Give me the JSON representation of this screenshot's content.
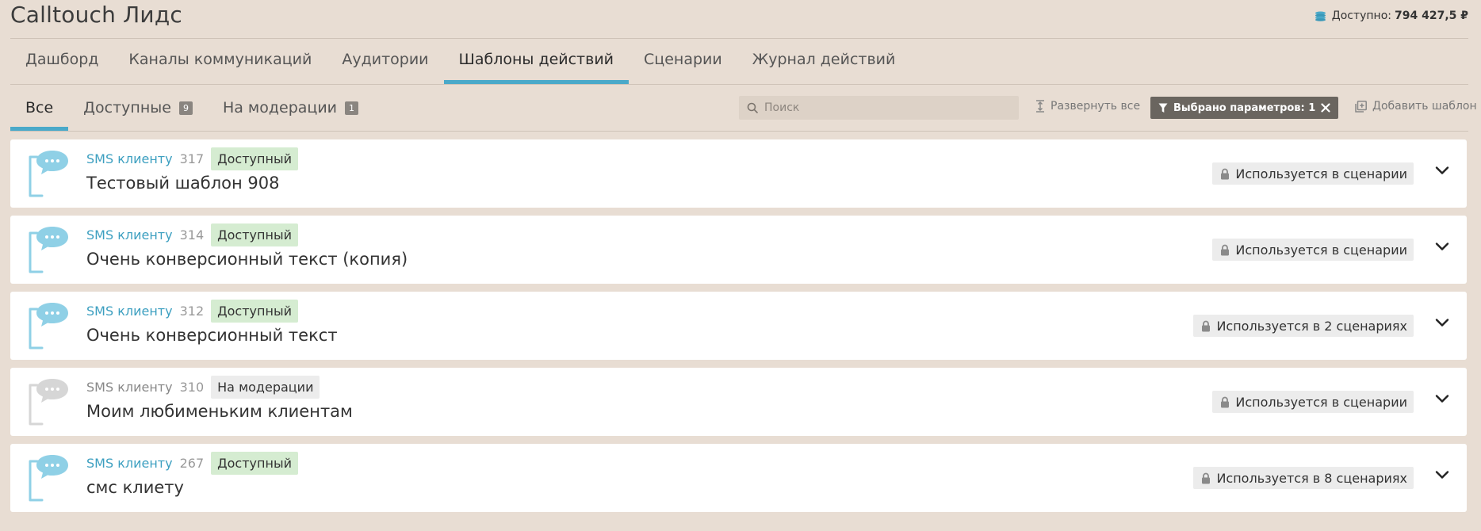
{
  "app": {
    "title": "Calltouch Лидс",
    "balance_label": "Доступно:",
    "balance_value": "794 427,5 ₽"
  },
  "nav": {
    "tabs": [
      {
        "label": "Дашборд",
        "active": false
      },
      {
        "label": "Каналы коммуникаций",
        "active": false
      },
      {
        "label": "Аудитории",
        "active": false
      },
      {
        "label": "Шаблоны действий",
        "active": true
      },
      {
        "label": "Сценарии",
        "active": false
      },
      {
        "label": "Журнал действий",
        "active": false
      }
    ]
  },
  "subnav": {
    "tabs": [
      {
        "label": "Все",
        "count": null,
        "active": true
      },
      {
        "label": "Доступные",
        "count": "9",
        "active": false
      },
      {
        "label": "На модерации",
        "count": "1",
        "active": false
      }
    ],
    "search_placeholder": "Поиск",
    "expand_all_label": "Развернуть все",
    "filter_label": "Выбрано параметров: 1",
    "add_template_label": "Добавить шаблон"
  },
  "templates": [
    {
      "channel": "SMS клиенту",
      "id": "317",
      "status": "Доступный",
      "status_kind": "available",
      "title": "Тестовый шаблон 908",
      "usage": "Используется в сценарии"
    },
    {
      "channel": "SMS клиенту",
      "id": "314",
      "status": "Доступный",
      "status_kind": "available",
      "title": "Очень конверсионный текст (копия)",
      "usage": "Используется в сценарии"
    },
    {
      "channel": "SMS клиенту",
      "id": "312",
      "status": "Доступный",
      "status_kind": "available",
      "title": "Очень конверсионный текст",
      "usage": "Используется в 2 сценариях"
    },
    {
      "channel": "SMS клиенту",
      "id": "310",
      "status": "На модерации",
      "status_kind": "moderation",
      "title": "Моим любименьким клиентам",
      "usage": "Используется в сценарии"
    },
    {
      "channel": "SMS клиенту",
      "id": "267",
      "status": "Доступный",
      "status_kind": "available",
      "title": "смс клиету",
      "usage": "Используется в 8 сценариях"
    }
  ],
  "colors": {
    "background": "#e8ddd3",
    "accent": "#4aa9c9",
    "available_badge": "#d5ecd1",
    "moderation_badge": "#ececec",
    "filter_chip": "#6a655f",
    "icon_active": "#8fd0e6",
    "icon_inactive": "#d6d6d6"
  },
  "icons": {
    "balance": "coins-icon",
    "search": "search-icon",
    "expand_all": "expand-vertical-icon",
    "filter": "filter-icon",
    "filter_close": "close-icon",
    "add_template": "add-square-icon",
    "template": "sms-phone-bubble-icon",
    "usage": "lock-icon",
    "expand_row": "chevron-down-icon"
  }
}
